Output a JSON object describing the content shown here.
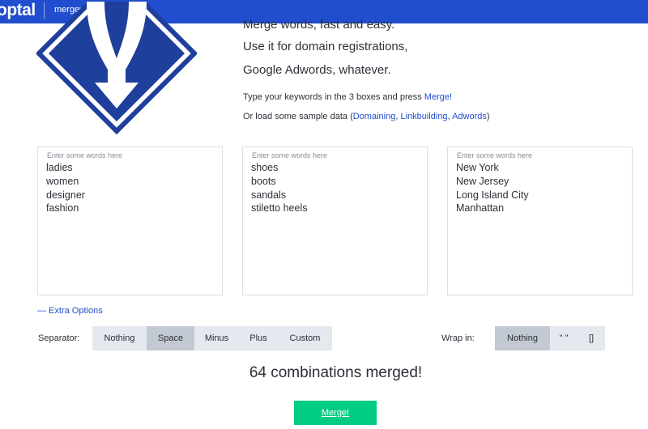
{
  "header": {
    "brand": "optal",
    "app_name": "mergewords"
  },
  "hero": {
    "headline_cut": "Merge words, fast and easy.",
    "headline_1": "Use it for domain registrations,",
    "headline_2": "Google Adwords, whatever.",
    "instruction_prefix": "Type your keywords in the 3 boxes and press ",
    "instruction_merge_link": "Merge!",
    "sample_prefix": "Or load some sample data (",
    "sample_links": [
      "Domaining",
      "Linkbuilding",
      "Adwords"
    ],
    "sample_sep": ", ",
    "sample_suffix": ")"
  },
  "boxes": [
    {
      "placeholder": "Enter some words here",
      "words": [
        "ladies",
        "women",
        "designer",
        "fashion"
      ]
    },
    {
      "placeholder": "Enter some words here",
      "words": [
        "shoes",
        "boots",
        "sandals",
        "stiletto heels"
      ]
    },
    {
      "placeholder": "Enter some words here",
      "words": [
        "New York",
        "New Jersey",
        "Long Island City",
        "Manhattan"
      ]
    }
  ],
  "extra_options": "— Extra Options",
  "separator": {
    "label": "Separator:",
    "options": [
      "Nothing",
      "Space",
      "Minus",
      "Plus",
      "Custom"
    ],
    "selected": "Space"
  },
  "wrap": {
    "label": "Wrap in:",
    "options": [
      "Nothing",
      "\" \"",
      "[]"
    ],
    "selected": "Nothing"
  },
  "result": {
    "count_text": "64 combinations merged!"
  },
  "merge_button": "Merge!",
  "colors": {
    "brand_blue": "#204ecf",
    "merge_green": "#00cc83",
    "segment_bg": "#e5e8ee",
    "segment_active": "#c3c9d2"
  }
}
